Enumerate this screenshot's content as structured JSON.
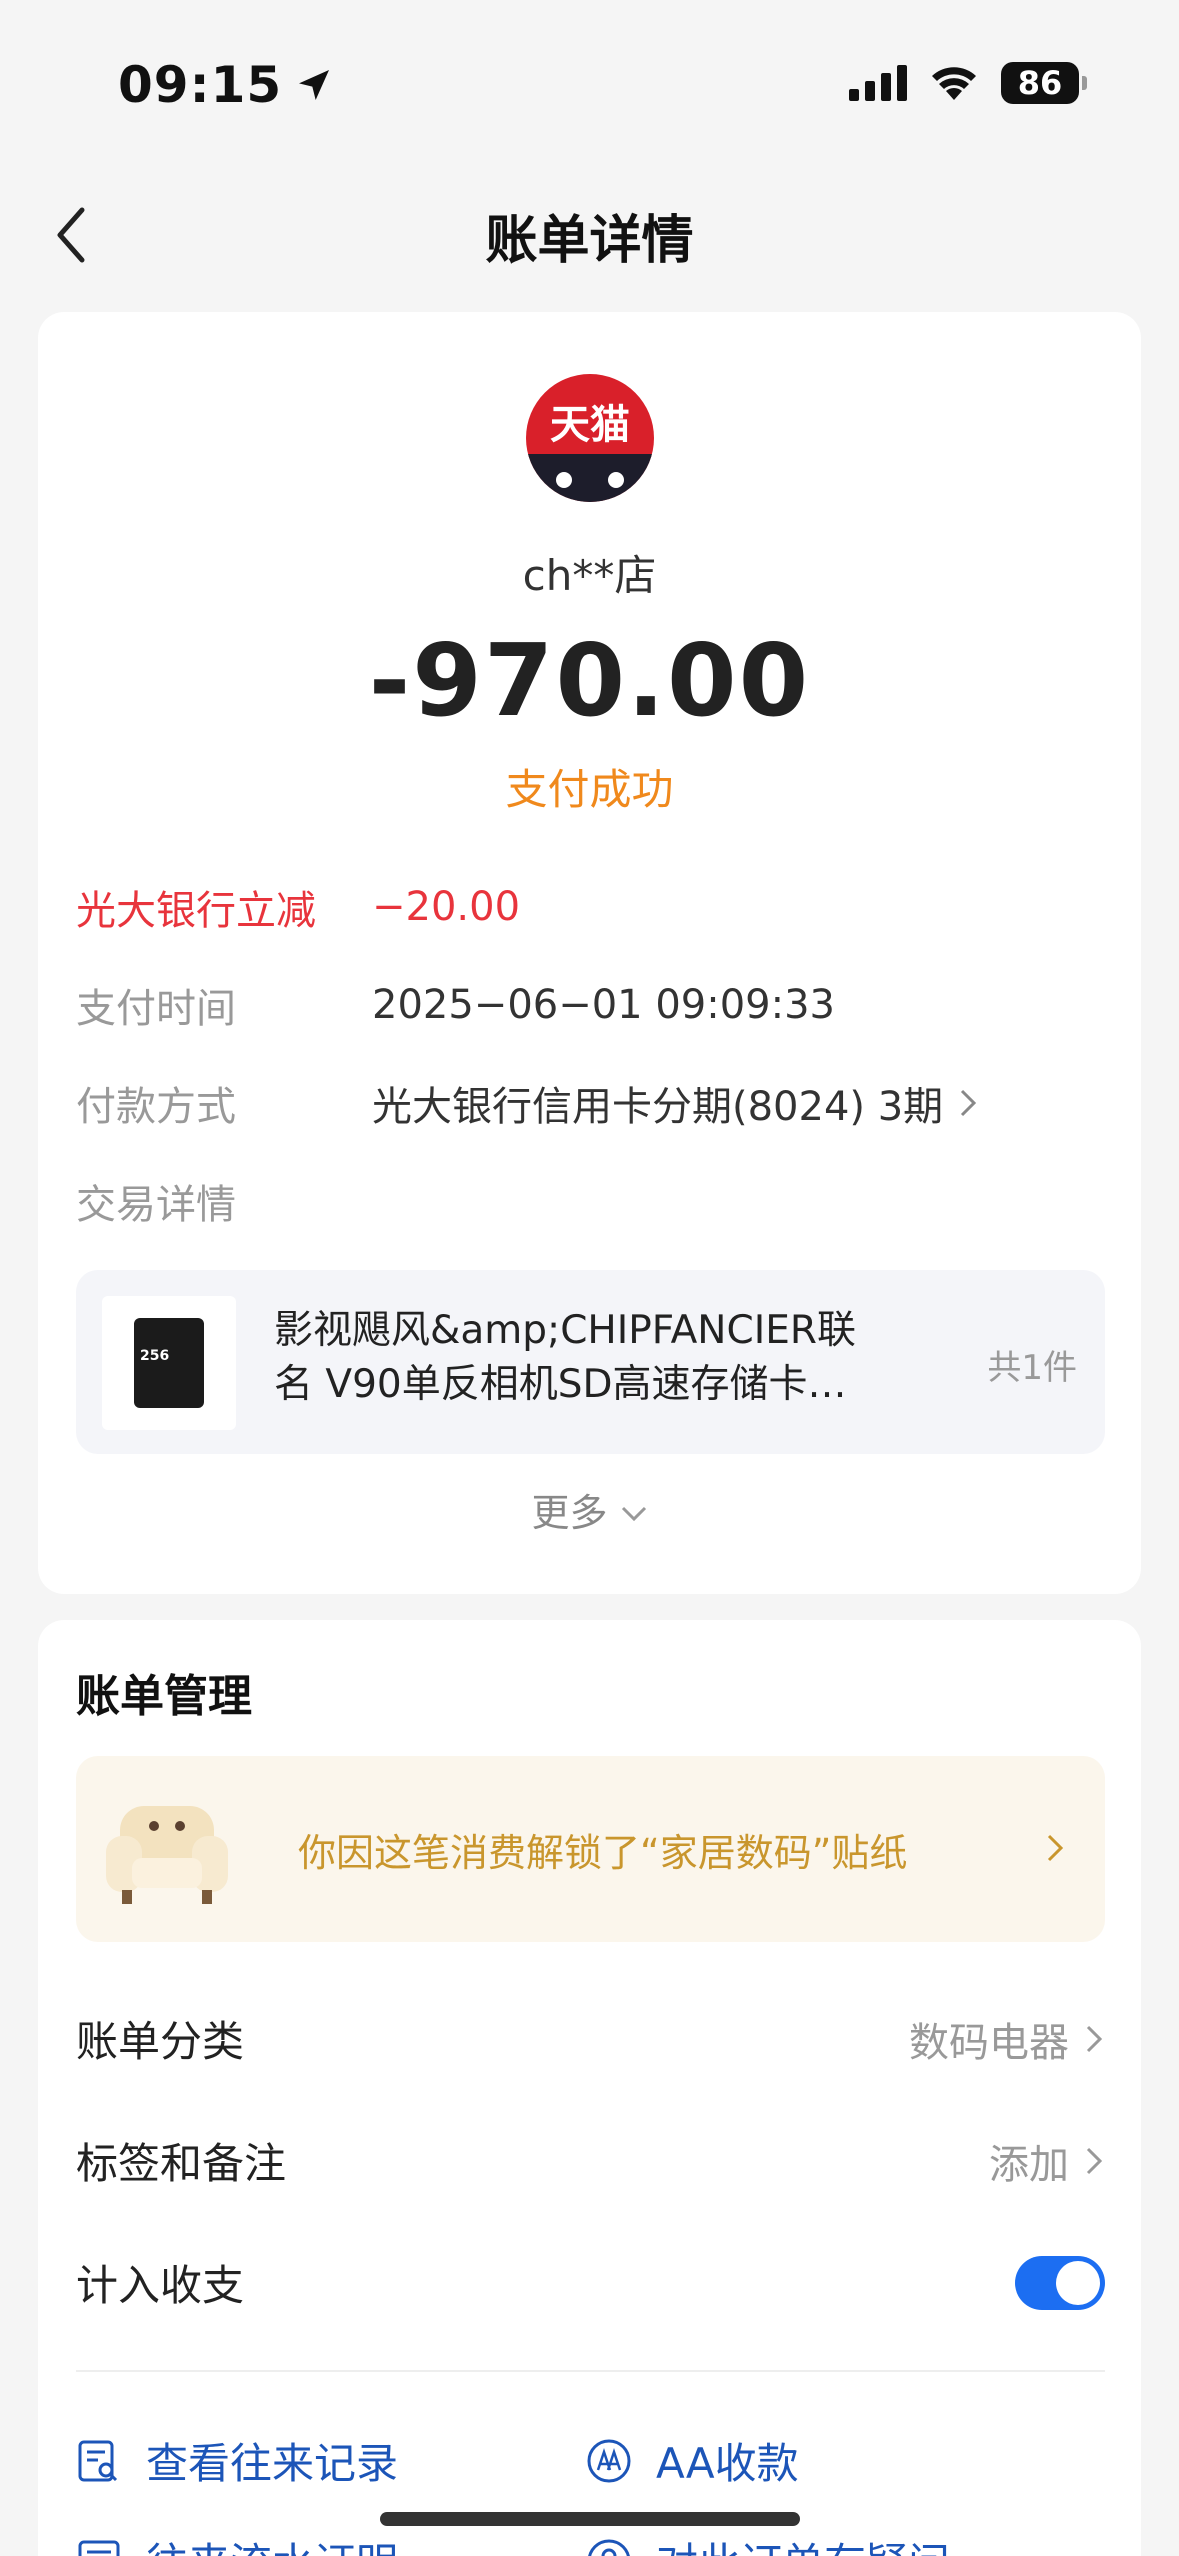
{
  "status_bar": {
    "time": "09:15",
    "battery": "86"
  },
  "nav": {
    "title": "账单详情"
  },
  "bill": {
    "logo_text": "天猫",
    "merchant": "ch**店",
    "amount": "-970.00",
    "status": "支付成功",
    "discount": {
      "label": "光大银行立减",
      "value": "−20.00"
    },
    "pay_time": {
      "label": "支付时间",
      "value": "2025−06−01 09:09:33"
    },
    "pay_method": {
      "label": "付款方式",
      "value": "光大银行信用卡分期(8024) 3期"
    },
    "trade_detail_label": "交易详情",
    "goods": {
      "title": "影视飓风&amp;CHIPFANCIER联名 V90单反相机SD高速存储卡…",
      "count": "共1件",
      "card_label": "256"
    },
    "more": "更多"
  },
  "management": {
    "title": "账单管理",
    "sticker_text": "你因这笔消费解锁了“家居数码”贴纸",
    "category": {
      "label": "账单分类",
      "value": "数码电器"
    },
    "tags": {
      "label": "标签和备注",
      "value": "添加"
    },
    "include": {
      "label": "计入收支",
      "on": true
    },
    "links": [
      {
        "label": "查看往来记录",
        "icon": "record-search-icon"
      },
      {
        "label": "AA收款",
        "icon": "aa-icon"
      },
      {
        "label": "往来流水证明",
        "icon": "statement-icon"
      },
      {
        "label": "对此订单有疑问",
        "icon": "question-icon"
      }
    ]
  },
  "colors": {
    "accent_blue": "#1c6ef2",
    "success_orange": "#f0891c",
    "discount_red": "#e8343c",
    "sticker_gold": "#c9962d"
  }
}
